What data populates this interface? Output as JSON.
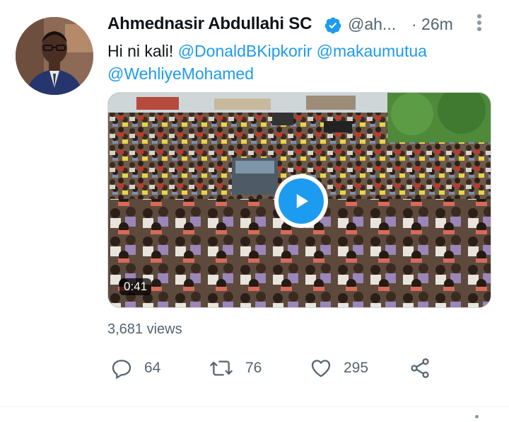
{
  "tweet": {
    "author_name": "Ahmednasir Abdullahi SC",
    "handle": "@ah...",
    "time": "· 26m",
    "text": "Hi ni kali!",
    "mentions": [
      "@DonaldBKipkorir",
      "@makaumutua",
      "@WehliyeMohamed"
    ],
    "video_duration": "0:41",
    "views": "3,681 views",
    "reply_count": "64",
    "retweet_count": "76",
    "like_count": "295"
  },
  "colors": {
    "accent": "#1d9bf0",
    "secondary_text": "#536471",
    "primary_text": "#0f1419"
  },
  "icons": {
    "verified": "verified-badge-icon",
    "more": "more-vertical-icon",
    "play": "play-icon",
    "reply": "reply-icon",
    "retweet": "retweet-icon",
    "like": "heart-icon",
    "share": "share-icon"
  }
}
